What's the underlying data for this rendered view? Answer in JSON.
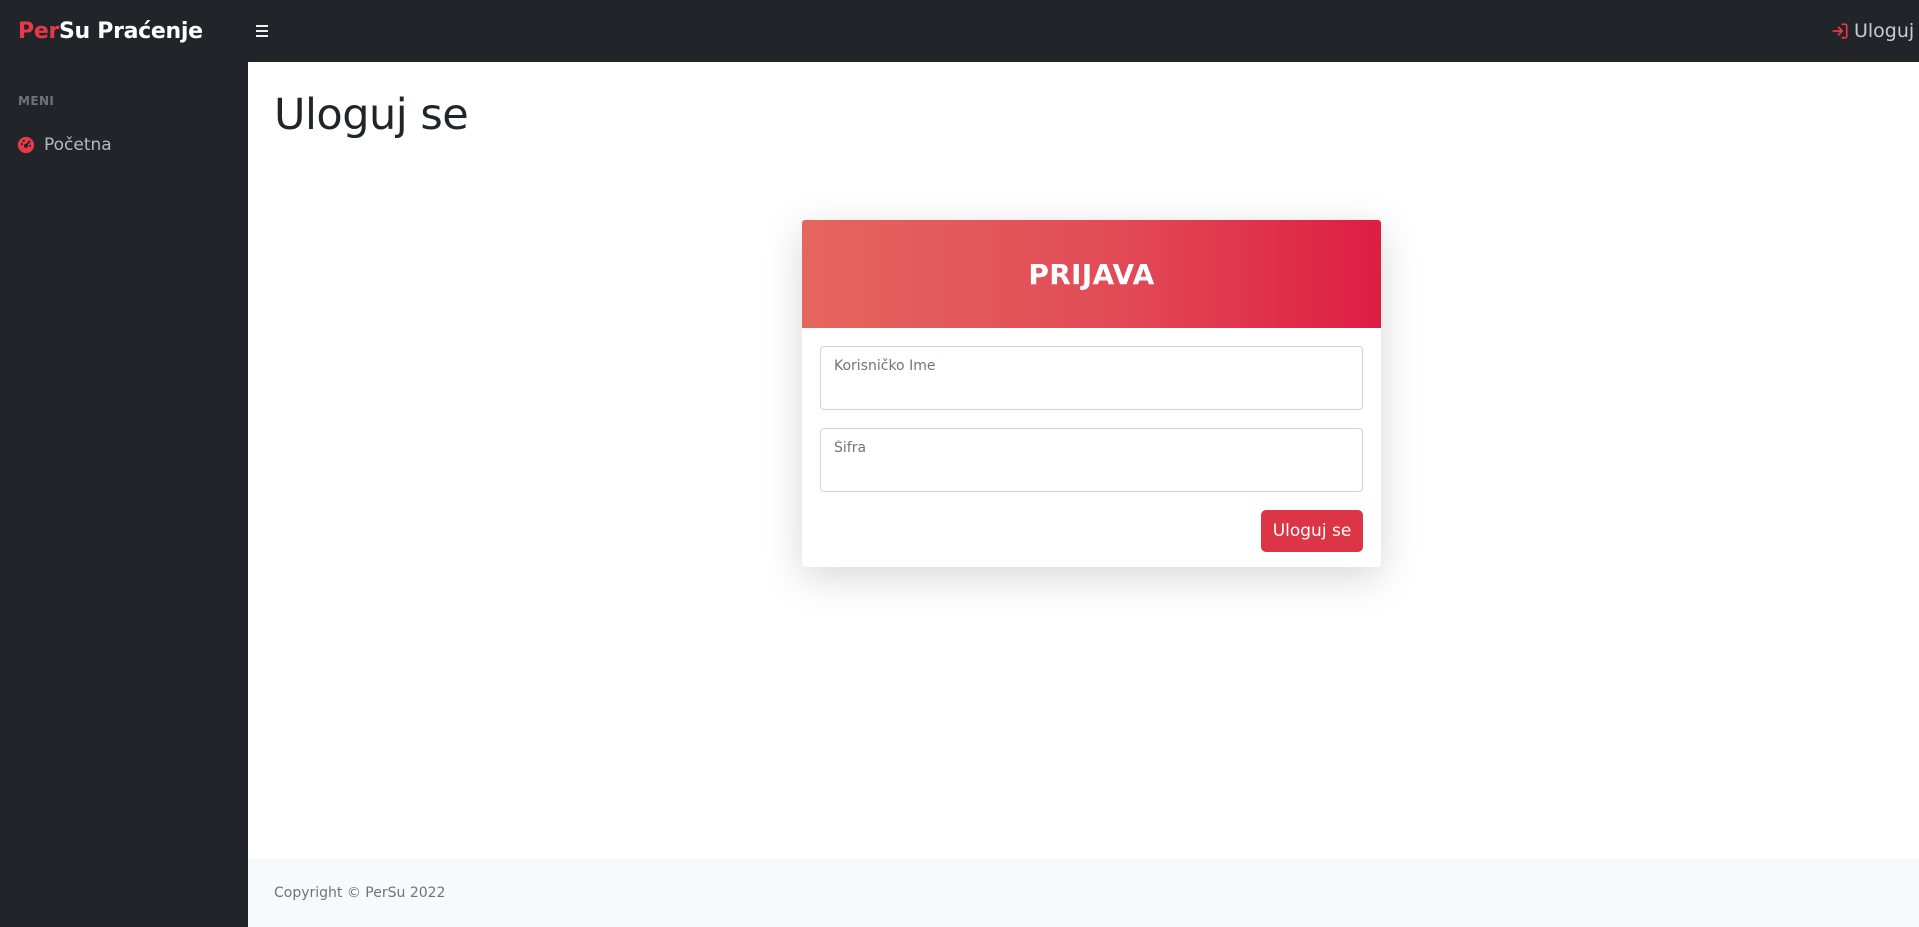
{
  "brand": {
    "accent": "Per",
    "rest": "Su Praćenje"
  },
  "topnav": {
    "login_link": "Uloguj se"
  },
  "sidebar": {
    "heading": "MENI",
    "items": [
      {
        "label": "Početna",
        "icon": "tachometer-icon"
      }
    ]
  },
  "page": {
    "title": "Uloguj se"
  },
  "login_card": {
    "header": "PRIJAVA",
    "username_placeholder": "Korisničko Ime",
    "password_placeholder": "Šifra",
    "submit_label": "Uloguj se"
  },
  "footer": {
    "copyright": "Copyright © PerSu 2022"
  },
  "colors": {
    "accent": "#dc3545",
    "nav_bg": "#212529",
    "header_gradient_start": "#e4665e",
    "header_gradient_end": "#de1d43"
  }
}
